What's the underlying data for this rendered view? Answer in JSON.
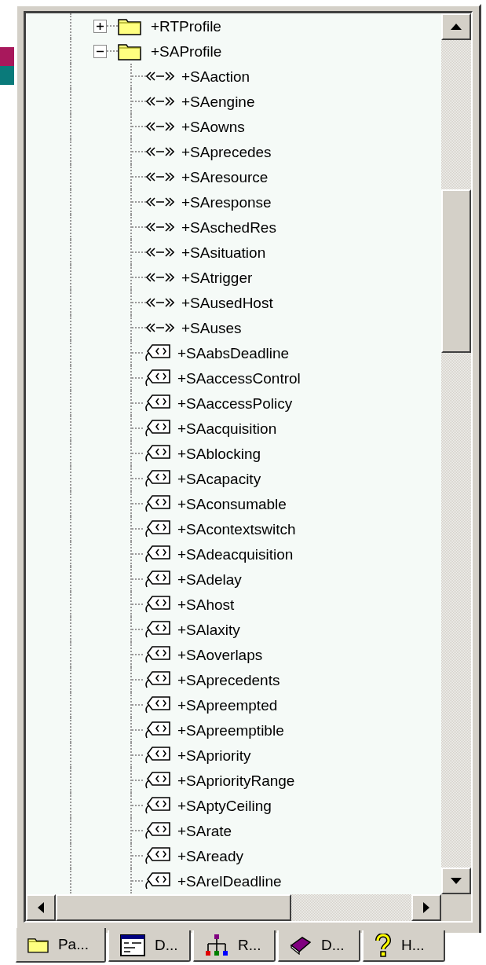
{
  "tree": [
    {
      "label": "+RTProfile",
      "kind": "folder",
      "expanded": false
    },
    {
      "label": "+SAProfile",
      "kind": "folder",
      "expanded": true,
      "children": [
        {
          "label": "+SAaction",
          "kind": "association"
        },
        {
          "label": "+SAengine",
          "kind": "association"
        },
        {
          "label": "+SAowns",
          "kind": "association"
        },
        {
          "label": "+SAprecedes",
          "kind": "association"
        },
        {
          "label": "+SAresource",
          "kind": "association"
        },
        {
          "label": "+SAresponse",
          "kind": "association"
        },
        {
          "label": "+SAschedRes",
          "kind": "association"
        },
        {
          "label": "+SAsituation",
          "kind": "association"
        },
        {
          "label": "+SAtrigger",
          "kind": "association"
        },
        {
          "label": "+SAusedHost",
          "kind": "association"
        },
        {
          "label": "+SAuses",
          "kind": "association"
        },
        {
          "label": "+SAabsDeadline",
          "kind": "tag"
        },
        {
          "label": "+SAaccessControl",
          "kind": "tag"
        },
        {
          "label": "+SAaccessPolicy",
          "kind": "tag"
        },
        {
          "label": "+SAacquisition",
          "kind": "tag"
        },
        {
          "label": "+SAblocking",
          "kind": "tag"
        },
        {
          "label": "+SAcapacity",
          "kind": "tag"
        },
        {
          "label": "+SAconsumable",
          "kind": "tag"
        },
        {
          "label": "+SAcontextswitch",
          "kind": "tag"
        },
        {
          "label": "+SAdeacquisition",
          "kind": "tag"
        },
        {
          "label": "+SAdelay",
          "kind": "tag"
        },
        {
          "label": "+SAhost",
          "kind": "tag"
        },
        {
          "label": "+SAlaxity",
          "kind": "tag"
        },
        {
          "label": "+SAoverlaps",
          "kind": "tag"
        },
        {
          "label": "+SAprecedents",
          "kind": "tag"
        },
        {
          "label": "+SApreempted",
          "kind": "tag"
        },
        {
          "label": "+SApreemptible",
          "kind": "tag"
        },
        {
          "label": "+SApriority",
          "kind": "tag"
        },
        {
          "label": "+SApriorityRange",
          "kind": "tag"
        },
        {
          "label": "+SAptyCeiling",
          "kind": "tag"
        },
        {
          "label": "+SArate",
          "kind": "tag"
        },
        {
          "label": "+SAready",
          "kind": "tag"
        },
        {
          "label": "+SArelDeadline",
          "kind": "tag"
        }
      ]
    }
  ],
  "tabs": [
    {
      "label": "Pa...",
      "kind": "folder",
      "selected": true
    },
    {
      "label": "D...",
      "kind": "window",
      "selected": false
    },
    {
      "label": "R...",
      "kind": "hierarchy",
      "selected": false
    },
    {
      "label": "D...",
      "kind": "book",
      "selected": false
    },
    {
      "label": "H...",
      "kind": "help",
      "selected": false
    }
  ]
}
